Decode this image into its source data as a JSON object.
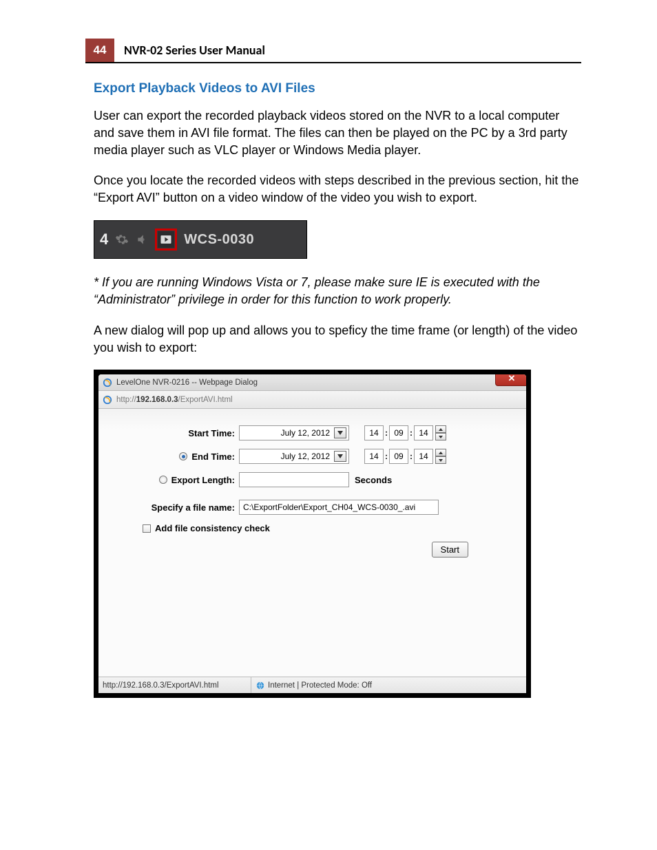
{
  "header": {
    "page_number": "44",
    "title": "NVR-02 Series User Manual"
  },
  "section": {
    "heading": "Export Playback Videos to AVI Files",
    "para1": "User can export the recorded playback videos stored on the NVR to a local computer and save them in AVI file format. The files can then be played on the PC by a 3rd party media player such as VLC player or Windows Media player.",
    "para2": "Once you locate the recorded videos with steps described in the previous section, hit the “Export AVI” button on a video window of the video you wish to export.",
    "note": "* If you are running Windows Vista or 7, please make sure IE is executed with the “Administrator” privilege in order for this function to work properly.",
    "para3": "A new dialog will pop up and allows you to speficy the time frame (or length) of the video you wish to export:"
  },
  "video_toolbar": {
    "channel_number": "4",
    "camera_label": "WCS-0030"
  },
  "dialog": {
    "title": "LevelOne NVR-0216 -- Webpage Dialog",
    "url_prefix": "http://",
    "url_host": "192.168.0.3",
    "url_path": "/ExportAVI.html",
    "close_glyph": "✕",
    "form": {
      "start_time_label": "Start Time:",
      "end_time_label": "End Time:",
      "export_length_label": "Export Length:",
      "specify_filename_label": "Specify a file name:",
      "consistency_label": "Add file consistency check",
      "seconds_label": "Seconds",
      "start_date": "July 12, 2012",
      "end_date": "July 12, 2012",
      "start_hh": "14",
      "start_mm": "09",
      "start_ss": "14",
      "end_hh": "14",
      "end_mm": "09",
      "end_ss": "14",
      "filename_value": "C:\\ExportFolder\\Export_CH04_WCS-0030_.avi",
      "start_button": "Start"
    },
    "status": {
      "left": "http://192.168.0.3/ExportAVI.html",
      "right": "Internet | Protected Mode: Off"
    }
  }
}
